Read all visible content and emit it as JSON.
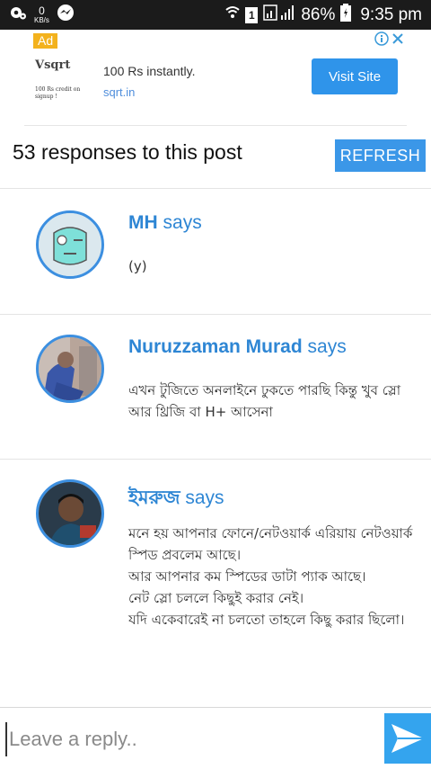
{
  "status_bar": {
    "net_speed": "0",
    "net_unit": "KB/s",
    "sim_label": "1",
    "battery": "86%",
    "time": "9:35 pm"
  },
  "ad": {
    "badge": "Ad",
    "logo_text": "Vsqrt",
    "logo_small": "100 Rs credit on signup !",
    "headline": "100 Rs instantly.",
    "url": "sqrt.in",
    "cta": "Visit Site"
  },
  "header": {
    "title": "53 responses to this post",
    "refresh_label": "REFRESH"
  },
  "comments": [
    {
      "author": "MH",
      "says": "says",
      "text": "(y)"
    },
    {
      "author": "Nuruzzaman Murad",
      "says": "says",
      "text": "এখন টুজিতে অনলাইনে ঢুকতে পারছি কিন্তু খুব স্লো আর থ্রিজি বা H+ আসেনা"
    },
    {
      "author": "ইমরুজ",
      "says": "says",
      "text": "মনে হয় আপনার ফোনে/নেটওয়ার্ক এরিয়ায় নেটওয়ার্ক স্পিড প্রবলেম আছে।\nআর আপনার কম স্পিডের ডাটা প্যাক আছে।\nনেট স্লো চললে কিছুই করার নেই।\nযদি একেবারেই না চলতো তাহলে কিছু করার ছিলো।"
    }
  ],
  "reply": {
    "placeholder": "Leave a reply.."
  },
  "colors": {
    "accent": "#3b97e8",
    "author": "#2e86d4",
    "ad_badge": "#f3b21d",
    "send": "#34a4ee"
  }
}
